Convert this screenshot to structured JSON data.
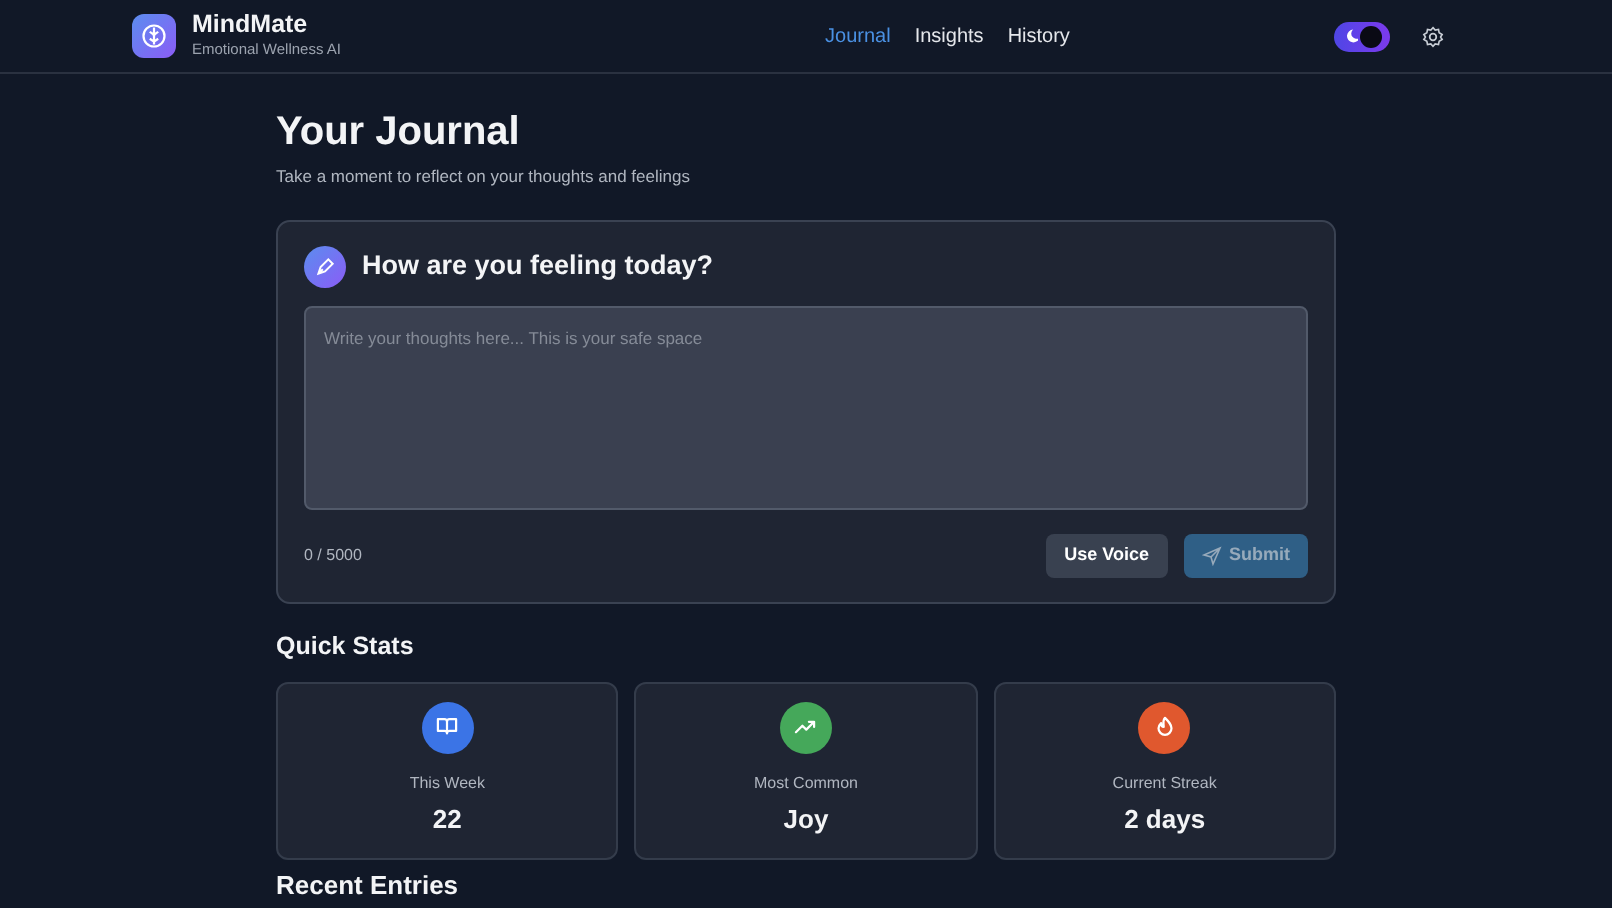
{
  "brand": {
    "name": "MindMate",
    "tagline": "Emotional Wellness AI"
  },
  "nav": [
    {
      "label": "Journal",
      "selected": true
    },
    {
      "label": "Insights",
      "selected": false
    },
    {
      "label": "History",
      "selected": false
    }
  ],
  "theme_toggle": {
    "on": true
  },
  "page": {
    "title": "Your Journal",
    "subtitle": "Take a moment to reflect on your thoughts and feelings"
  },
  "journal": {
    "heading": "How are you feeling today?",
    "placeholder": "Write your thoughts here... This is your safe space",
    "counter": "0 / 5000",
    "buttons": [
      {
        "label": "Use Voice",
        "kind": "secondary"
      },
      {
        "label": "Submit",
        "kind": "primary",
        "disabled": true
      }
    ]
  },
  "quick_stats": {
    "title": "Quick Stats",
    "items": [
      {
        "kind": "book",
        "label": "This Week",
        "value": "22",
        "color": "#3b74e6"
      },
      {
        "kind": "trend",
        "label": "Most Common",
        "value": "Joy",
        "color": "#45a85a"
      },
      {
        "kind": "flame",
        "label": "Current Streak",
        "value": "2 days",
        "color": "#e0582e"
      }
    ]
  },
  "recent": {
    "title": "Recent Entries"
  }
}
